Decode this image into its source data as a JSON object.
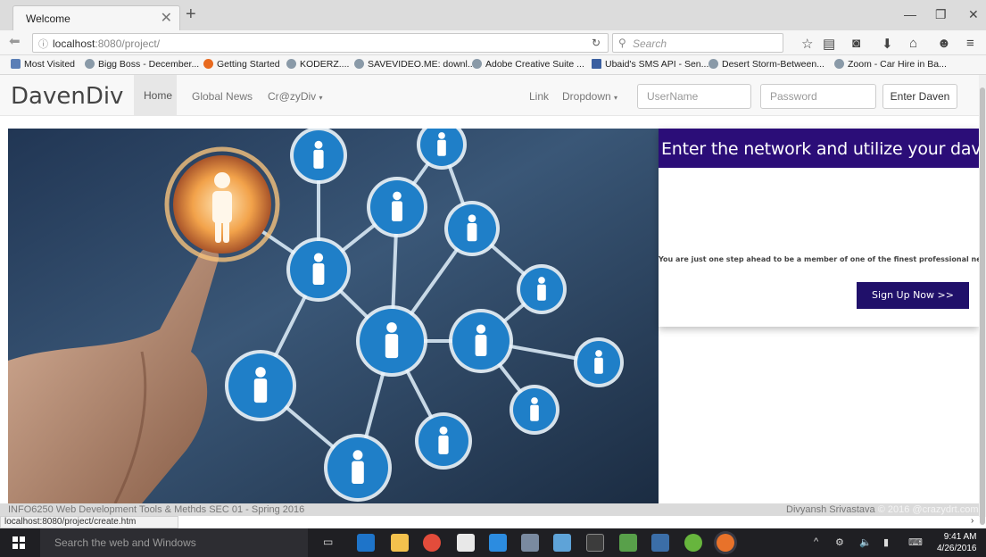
{
  "browser": {
    "tab_title": "Welcome",
    "url_host": "localhost",
    "url_rest": ":8080/project/",
    "search_placeholder": "Search",
    "bookmarks": [
      "Most Visited",
      "Bigg Boss - December...",
      "Getting Started",
      "KODERZ....",
      "SAVEVIDEO.ME: downl...",
      "Adobe Creative Suite ...",
      "Ubaid's SMS API - Sen...",
      "Desert Storm-Between...",
      "Zoom - Car Hire in Ba..."
    ],
    "status_url": "localhost:8080/project/create.htm"
  },
  "site": {
    "brand": "DavenDiv",
    "nav": {
      "home": "Home",
      "global_news": "Global News",
      "crazydiv": "Cr@zyDiv",
      "link": "Link",
      "dropdown": "Dropdown"
    },
    "login": {
      "username_placeholder": "UserName",
      "password_placeholder": "Password",
      "button": "Enter Daven"
    }
  },
  "panel": {
    "title": "Enter the network and utilize your daven",
    "message": "You are just one step ahead to be a member of one of the finest professional network",
    "button": "Sign Up Now >>"
  },
  "footer": {
    "course": "INFO6250 Web Development Tools & Methds SEC 01 - Spring 2016",
    "author": "Divyansh Srivastava",
    "copyright": "© 2016 @crazydrt.com"
  },
  "taskbar": {
    "search_placeholder": "Search the web and Windows",
    "time": "9:41 AM",
    "date": "4/26/2016"
  },
  "colors": {
    "panel_header": "#2b0d78",
    "signup_button": "#20106a",
    "hero_background": "#27384f",
    "node_blue": "#1f7fc8"
  }
}
